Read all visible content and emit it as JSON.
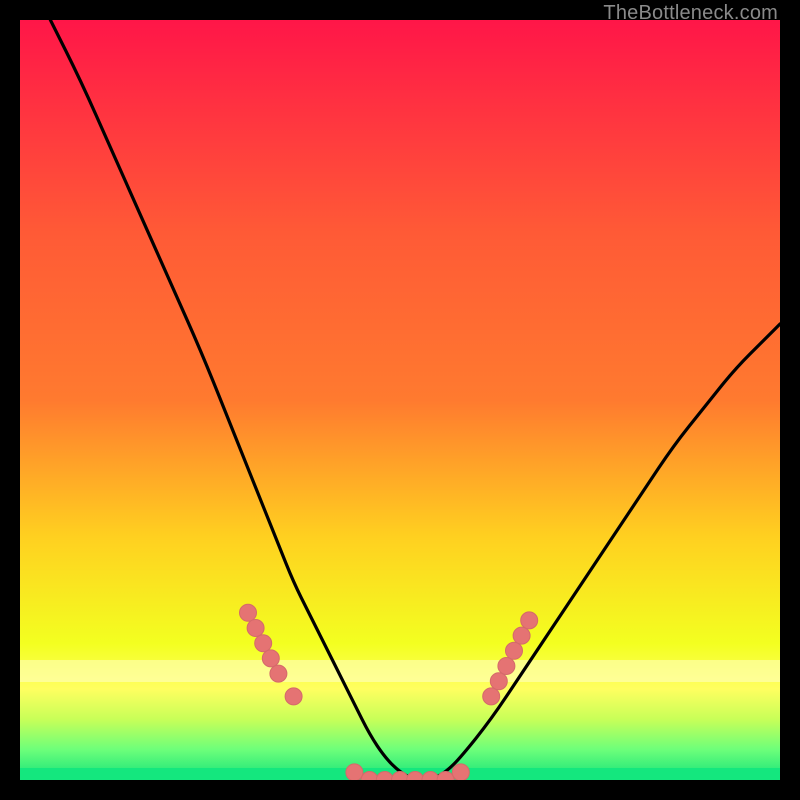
{
  "attribution": "TheBottleneck.com",
  "colors": {
    "top": "#ff1648",
    "mid1": "#ff7a2f",
    "mid2": "#ffd020",
    "mid3": "#f3ff20",
    "bottom_band_top": "#ffff60",
    "bottom_band_mid": "#c8ff58",
    "bottom_band_low": "#6dff7a",
    "green_line": "#12e27a",
    "curve": "#000000",
    "marker": "#e57373",
    "marker_stroke": "#d46a6a"
  },
  "chart_data": {
    "type": "line",
    "title": "",
    "xlabel": "",
    "ylabel": "",
    "xlim": [
      0,
      100
    ],
    "ylim": [
      0,
      100
    ],
    "curve": {
      "x": [
        4,
        8,
        12,
        16,
        20,
        24,
        28,
        30,
        32,
        34,
        36,
        38,
        40,
        42,
        44,
        46,
        48,
        50,
        52,
        54,
        56,
        58,
        62,
        66,
        70,
        74,
        78,
        82,
        86,
        90,
        94,
        98,
        100
      ],
      "y": [
        100,
        92,
        83,
        74,
        65,
        56,
        46,
        41,
        36,
        31,
        26,
        22,
        18,
        14,
        10,
        6,
        3,
        1,
        0,
        0,
        1,
        3,
        8,
        14,
        20,
        26,
        32,
        38,
        44,
        49,
        54,
        58,
        60
      ]
    },
    "markers": {
      "x": [
        30,
        31,
        32,
        33,
        34,
        36,
        44,
        46,
        48,
        50,
        52,
        54,
        56,
        58,
        62,
        63,
        64,
        65,
        66,
        67
      ],
      "y": [
        22,
        20,
        18,
        16,
        14,
        11,
        1,
        0,
        0,
        0,
        0,
        0,
        0,
        1,
        11,
        13,
        15,
        17,
        19,
        21
      ]
    }
  }
}
